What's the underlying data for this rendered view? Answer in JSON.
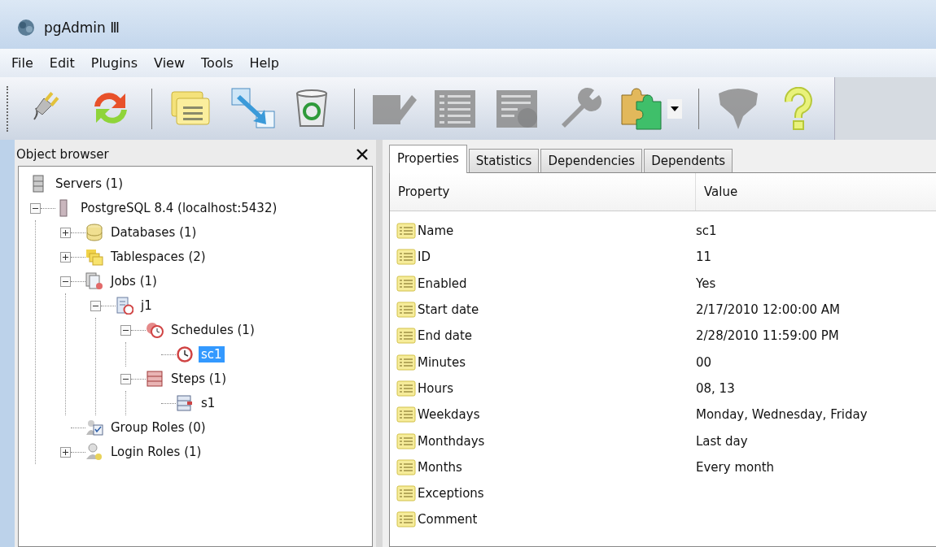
{
  "window": {
    "title": "pgAdmin Ⅲ"
  },
  "menu": [
    "File",
    "Edit",
    "Plugins",
    "View",
    "Tools",
    "Help"
  ],
  "toolbar": [
    {
      "kind": "connect",
      "disabled": false
    },
    {
      "kind": "refresh",
      "disabled": false
    },
    {
      "kind": "separator"
    },
    {
      "kind": "properties",
      "disabled": false
    },
    {
      "kind": "create",
      "disabled": false
    },
    {
      "kind": "delete",
      "disabled": false
    },
    {
      "kind": "separator"
    },
    {
      "kind": "edit",
      "disabled": true
    },
    {
      "kind": "grid",
      "disabled": true
    },
    {
      "kind": "grid-filter",
      "disabled": true
    },
    {
      "kind": "maintenance",
      "disabled": true
    },
    {
      "kind": "plugins",
      "disabled": false
    },
    {
      "kind": "separator"
    },
    {
      "kind": "filter",
      "disabled": true
    },
    {
      "kind": "help",
      "disabled": false
    }
  ],
  "object_browser": {
    "title": "Object browser",
    "tree": [
      {
        "label": "Servers (1)",
        "kind": "servers",
        "selected": false,
        "children": [
          {
            "label": "PostgreSQL 8.4 (localhost:5432)",
            "kind": "server",
            "selected": false,
            "expanded": true,
            "children": [
              {
                "label": "Databases (1)",
                "kind": "databases",
                "selected": false,
                "expanded": false
              },
              {
                "label": "Tablespaces (2)",
                "kind": "tablespaces",
                "selected": false,
                "expanded": false
              },
              {
                "label": "Jobs (1)",
                "kind": "jobs",
                "selected": false,
                "expanded": true,
                "children": [
                  {
                    "label": "j1",
                    "kind": "job",
                    "selected": false,
                    "expanded": true,
                    "children": [
                      {
                        "label": "Schedules (1)",
                        "kind": "schedules",
                        "selected": false,
                        "expanded": true,
                        "children": [
                          {
                            "label": "sc1",
                            "kind": "schedule",
                            "selected": true
                          }
                        ]
                      },
                      {
                        "label": "Steps (1)",
                        "kind": "steps",
                        "selected": false,
                        "expanded": true,
                        "children": [
                          {
                            "label": "s1",
                            "kind": "step",
                            "selected": false
                          }
                        ]
                      }
                    ]
                  }
                ]
              },
              {
                "label": "Group Roles (0)",
                "kind": "group-roles",
                "selected": false
              },
              {
                "label": "Login Roles (1)",
                "kind": "login-roles",
                "selected": false,
                "expanded": false
              }
            ]
          }
        ]
      }
    ]
  },
  "tabs": [
    {
      "label": "Properties",
      "selected": true
    },
    {
      "label": "Statistics",
      "selected": false
    },
    {
      "label": "Dependencies",
      "selected": false
    },
    {
      "label": "Dependents",
      "selected": false
    }
  ],
  "properties": {
    "columns": [
      "Property",
      "Value"
    ],
    "rows": [
      {
        "property": "Name",
        "value": "sc1"
      },
      {
        "property": "ID",
        "value": "11"
      },
      {
        "property": "Enabled",
        "value": "Yes"
      },
      {
        "property": "Start date",
        "value": "2/17/2010 12:00:00 AM"
      },
      {
        "property": "End date",
        "value": "2/28/2010 11:59:00 PM"
      },
      {
        "property": "Minutes",
        "value": "00"
      },
      {
        "property": "Hours",
        "value": "08, 13"
      },
      {
        "property": "Weekdays",
        "value": "Monday, Wednesday, Friday"
      },
      {
        "property": "Monthdays",
        "value": "Last day"
      },
      {
        "property": "Months",
        "value": "Every month"
      },
      {
        "property": "Exceptions"
      },
      {
        "property": "Comment"
      }
    ]
  }
}
